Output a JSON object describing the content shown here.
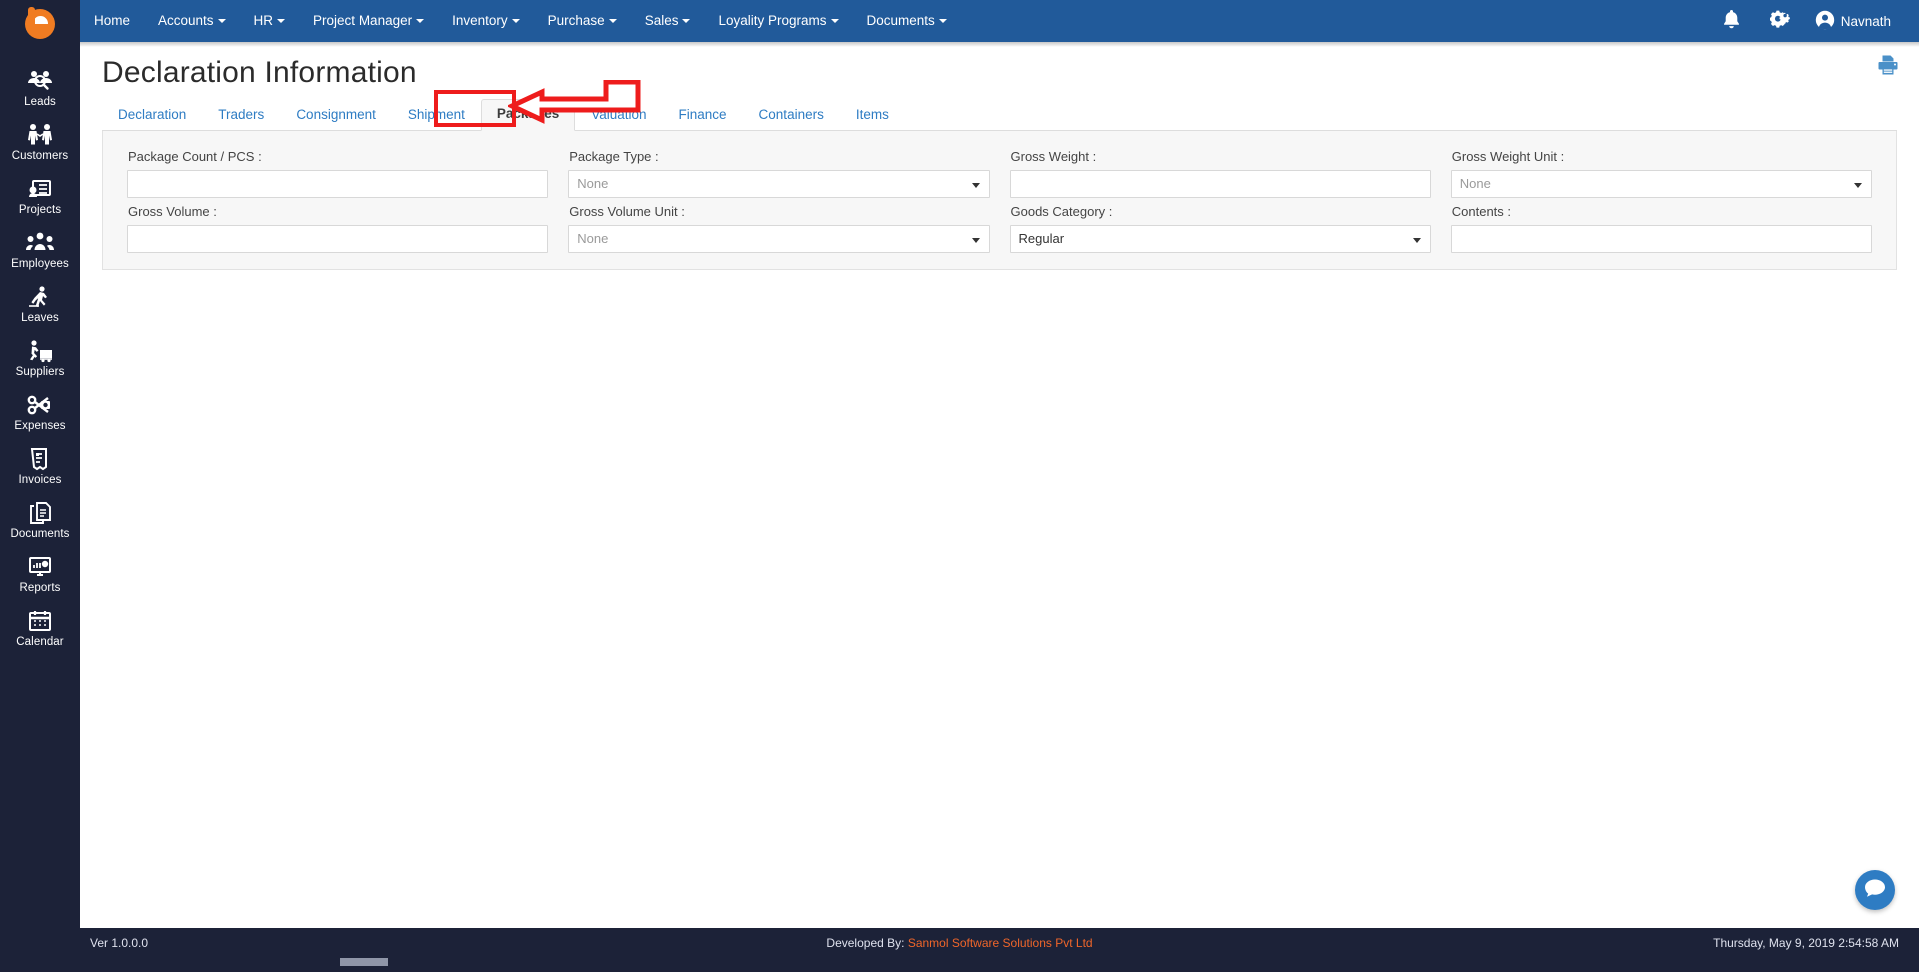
{
  "brand": {
    "logo_name": "company-logo"
  },
  "topnav": {
    "items": [
      {
        "label": "Home",
        "has_caret": false
      },
      {
        "label": "Accounts",
        "has_caret": true
      },
      {
        "label": "HR",
        "has_caret": true
      },
      {
        "label": "Project Manager",
        "has_caret": true
      },
      {
        "label": "Inventory",
        "has_caret": true
      },
      {
        "label": "Purchase",
        "has_caret": true
      },
      {
        "label": "Sales",
        "has_caret": true
      },
      {
        "label": "Loyality Programs",
        "has_caret": true
      },
      {
        "label": "Documents",
        "has_caret": true
      }
    ],
    "notifications_icon": "bell-icon",
    "settings_icon": "gears-icon",
    "user_icon": "user-circle-icon",
    "user_name": "Navnath"
  },
  "sidebar": {
    "items": [
      {
        "label": "Leads",
        "icon": "leads-icon"
      },
      {
        "label": "Customers",
        "icon": "customers-icon"
      },
      {
        "label": "Projects",
        "icon": "projects-icon"
      },
      {
        "label": "Employees",
        "icon": "employees-icon"
      },
      {
        "label": "Leaves",
        "icon": "leaves-icon"
      },
      {
        "label": "Suppliers",
        "icon": "suppliers-icon"
      },
      {
        "label": "Expenses",
        "icon": "expenses-icon"
      },
      {
        "label": "Invoices",
        "icon": "invoices-icon"
      },
      {
        "label": "Documents",
        "icon": "documents-icon"
      },
      {
        "label": "Reports",
        "icon": "reports-icon"
      },
      {
        "label": "Calendar",
        "icon": "calendar-icon"
      }
    ]
  },
  "page": {
    "title": "Declaration Information",
    "print_icon": "print-icon"
  },
  "tabs": [
    {
      "label": "Declaration",
      "active": false
    },
    {
      "label": "Traders",
      "active": false
    },
    {
      "label": "Consignment",
      "active": false
    },
    {
      "label": "Shipment",
      "active": false
    },
    {
      "label": "Packages",
      "active": true
    },
    {
      "label": "Valuation",
      "active": false
    },
    {
      "label": "Finance",
      "active": false
    },
    {
      "label": "Containers",
      "active": false
    },
    {
      "label": "Items",
      "active": false
    }
  ],
  "annotation": {
    "highlight_color": "#ee1c1c",
    "target_tab": "Packages",
    "shape": "red-rectangle-with-arrow"
  },
  "form": {
    "row1": [
      {
        "label": "Package Count / PCS :",
        "type": "text",
        "value": "",
        "placeholder": ""
      },
      {
        "label": "Package Type :",
        "type": "select",
        "value": "None",
        "is_placeholder": true
      },
      {
        "label": "Gross Weight :",
        "type": "text",
        "value": "",
        "placeholder": ""
      },
      {
        "label": "Gross Weight Unit :",
        "type": "select",
        "value": "None",
        "is_placeholder": true
      }
    ],
    "row2": [
      {
        "label": "Gross Volume :",
        "type": "text",
        "value": "",
        "placeholder": ""
      },
      {
        "label": "Gross Volume Unit :",
        "type": "select",
        "value": "None",
        "is_placeholder": true
      },
      {
        "label": "Goods Category :",
        "type": "select",
        "value": "Regular",
        "is_placeholder": false
      },
      {
        "label": "Contents :",
        "type": "text",
        "value": "",
        "placeholder": ""
      }
    ]
  },
  "chat": {
    "icon": "chat-bubble-icon"
  },
  "footer": {
    "version": "Ver 1.0.0.0",
    "developed_by_label": "Developed By:",
    "developer": "Sanmol Software Solutions Pvt Ltd",
    "datetime": "Thursday, May 9, 2019 2:54:58 AM"
  },
  "colors": {
    "nav_blue": "#215a9a",
    "sidebar_dark": "#1c2238",
    "accent_orange": "#f0662a",
    "link_blue": "#2e7cc3",
    "annotation_red": "#ee1c1c"
  }
}
